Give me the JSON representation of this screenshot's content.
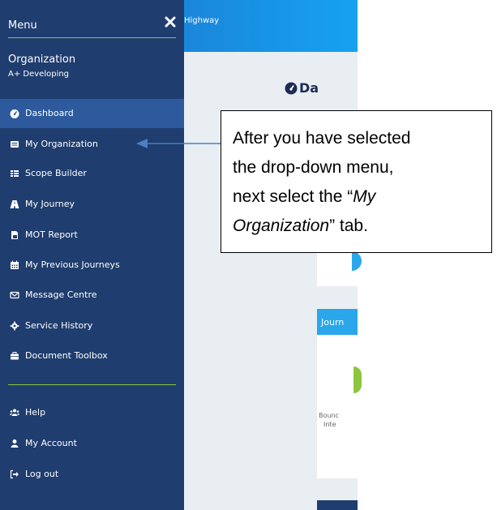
{
  "sidebar": {
    "title": "Menu",
    "organization_label": "Organization",
    "organization_value": "A+ Developing",
    "items": [
      {
        "label": "Dashboard",
        "icon": "dashboard-icon",
        "active": true
      },
      {
        "label": "My Organization",
        "icon": "list-icon",
        "active": false
      },
      {
        "label": "Scope Builder",
        "icon": "table-icon",
        "active": false
      },
      {
        "label": "My Journey",
        "icon": "road-icon",
        "active": false
      },
      {
        "label": "MOT Report",
        "icon": "report-icon",
        "active": false
      },
      {
        "label": "My Previous Journeys",
        "icon": "calendar-icon",
        "active": false
      },
      {
        "label": "Message Centre",
        "icon": "envelope-icon",
        "active": false
      },
      {
        "label": "Service History",
        "icon": "gear-icon",
        "active": false
      },
      {
        "label": "Document Toolbox",
        "icon": "briefcase-icon",
        "active": false
      }
    ],
    "footer_items": [
      {
        "label": "Help",
        "icon": "users-icon"
      },
      {
        "label": "My Account",
        "icon": "user-icon"
      },
      {
        "label": "Log out",
        "icon": "logout-icon"
      }
    ]
  },
  "main": {
    "topbar_text": "Highway",
    "dashboard_title": "Da",
    "journey_header": "Journ",
    "card_text_line1": "Bounc",
    "card_text_line2": "Inte"
  },
  "callout": {
    "line1": "After you have selected",
    "line2": "the drop-down menu,",
    "line3_prefix": "next select the “",
    "line3_italic": "My",
    "line4_italic": "Organization",
    "line4_suffix": "” tab."
  },
  "colors": {
    "sidebar_bg": "#1f3d6e",
    "active_item_bg": "#2c5a9c",
    "accent_green": "#8ec63f",
    "topbar_blue": "#1a86db",
    "arrow_blue": "#4a7fc1"
  }
}
